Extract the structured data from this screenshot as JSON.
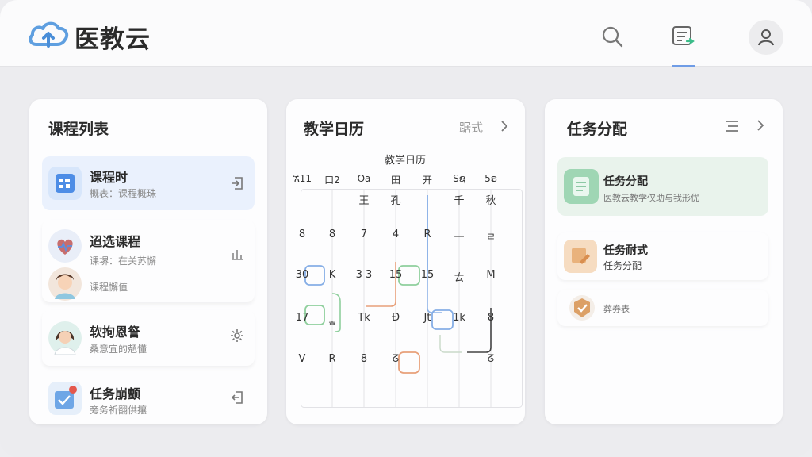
{
  "app": {
    "title": "医教云"
  },
  "colors": {
    "accent": "#6f9ce6",
    "active_bg": "#eaf1fd",
    "task_green": "#e9f3ec"
  },
  "nav": {
    "icons": [
      "search-icon",
      "task-icon",
      "user-icon"
    ]
  },
  "courses": {
    "title": "课程列表",
    "items": [
      {
        "title": "课程时",
        "sub": "概表：课程概珠",
        "icon": "course-grid-icon",
        "action_icon": "enter-icon"
      },
      {
        "title": "迢选课程",
        "sub": "课堺：在关苏懈",
        "sub2": "课程懈值",
        "icon": "heart-icon",
        "action_icon": "chart-icon"
      },
      {
        "title": "软拘恩詧",
        "sub": "桑意宜的兡懂",
        "icon": "doctor-icon",
        "action_icon": "gear-icon"
      },
      {
        "title": "任务崩颤",
        "sub": "旁务祈翻供攘",
        "icon": "task-edit-icon",
        "action_icon": "exit-icon"
      }
    ]
  },
  "calendar": {
    "title": "教学日历",
    "mode_label": "踞式",
    "grid_title": "教学日历",
    "weekdays": [
      "ኧ11",
      "口2",
      "Oa",
      "田",
      "开",
      "Sຊ",
      "5ຣ"
    ],
    "rows": [
      [
        "",
        "",
        "王",
        "孔",
        "",
        "千",
        "秋"
      ],
      [
        "8",
        "8",
        "7",
        "4",
        "R",
        "一",
        "ㄹ"
      ],
      [
        "30",
        "K",
        "3 3",
        "15",
        "15",
        "ㄊ",
        "M"
      ],
      [
        "17",
        "ᇂ",
        "Tk",
        "Ð",
        "Jt",
        "1k",
        "8"
      ],
      [
        "V",
        "R",
        "8",
        "ᘔ",
        "",
        "",
        "ᘔ"
      ]
    ]
  },
  "tasks": {
    "title": "任务分配",
    "items": [
      {
        "title": "任务分配",
        "sub": "医教云教学仅助与我形优",
        "icon": "doc-icon"
      },
      {
        "title": "任务耐式",
        "sub": "任务分配",
        "icon": "edit-icon"
      },
      {
        "title": "",
        "sub": "葬券表",
        "icon": "badge-icon"
      }
    ]
  }
}
